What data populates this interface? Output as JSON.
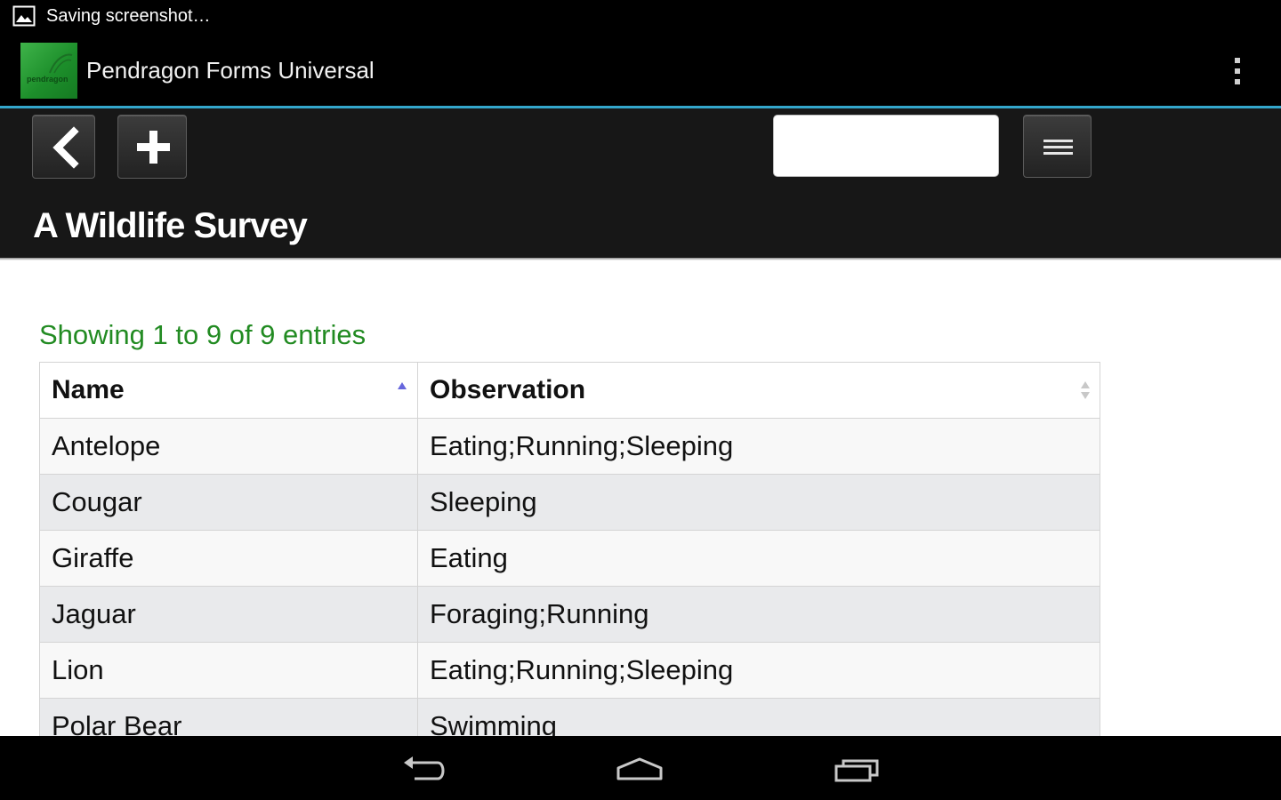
{
  "status_bar": {
    "notification_icon": "image-icon",
    "text": "Saving screenshot…"
  },
  "action_bar": {
    "logo_text": "pendragon",
    "app_title": "Pendragon Forms Universal",
    "overflow_icon": "more-vert-icon",
    "divider_color": "#33a6cc"
  },
  "toolbar": {
    "back_icon": "chevron-left-icon",
    "add_icon": "plus-icon",
    "search_value": "",
    "menu_icon": "hamburger-icon",
    "page_title": "A Wildlife Survey"
  },
  "table_info": "Showing 1 to 9 of 9 entries",
  "table": {
    "columns": [
      "Name",
      "Observation"
    ],
    "sort": {
      "column": "Name",
      "direction": "ascending"
    },
    "rows": [
      [
        "Antelope",
        "Eating;Running;Sleeping"
      ],
      [
        "Cougar",
        "Sleeping"
      ],
      [
        "Giraffe",
        "Eating"
      ],
      [
        "Jaguar",
        "Foraging;Running"
      ],
      [
        "Lion",
        "Eating;Running;Sleeping"
      ],
      [
        "Polar Bear",
        "Swimming"
      ]
    ]
  },
  "nav_bar": {
    "back_icon": "back-arrow-icon",
    "home_icon": "home-icon",
    "recents_icon": "recent-apps-icon"
  },
  "colors": {
    "entries_text": "#228b22",
    "header_bg": "#171717",
    "row_odd": "#f8f8f8",
    "row_even": "#e9eaec",
    "sort_active": "#6666dd"
  }
}
